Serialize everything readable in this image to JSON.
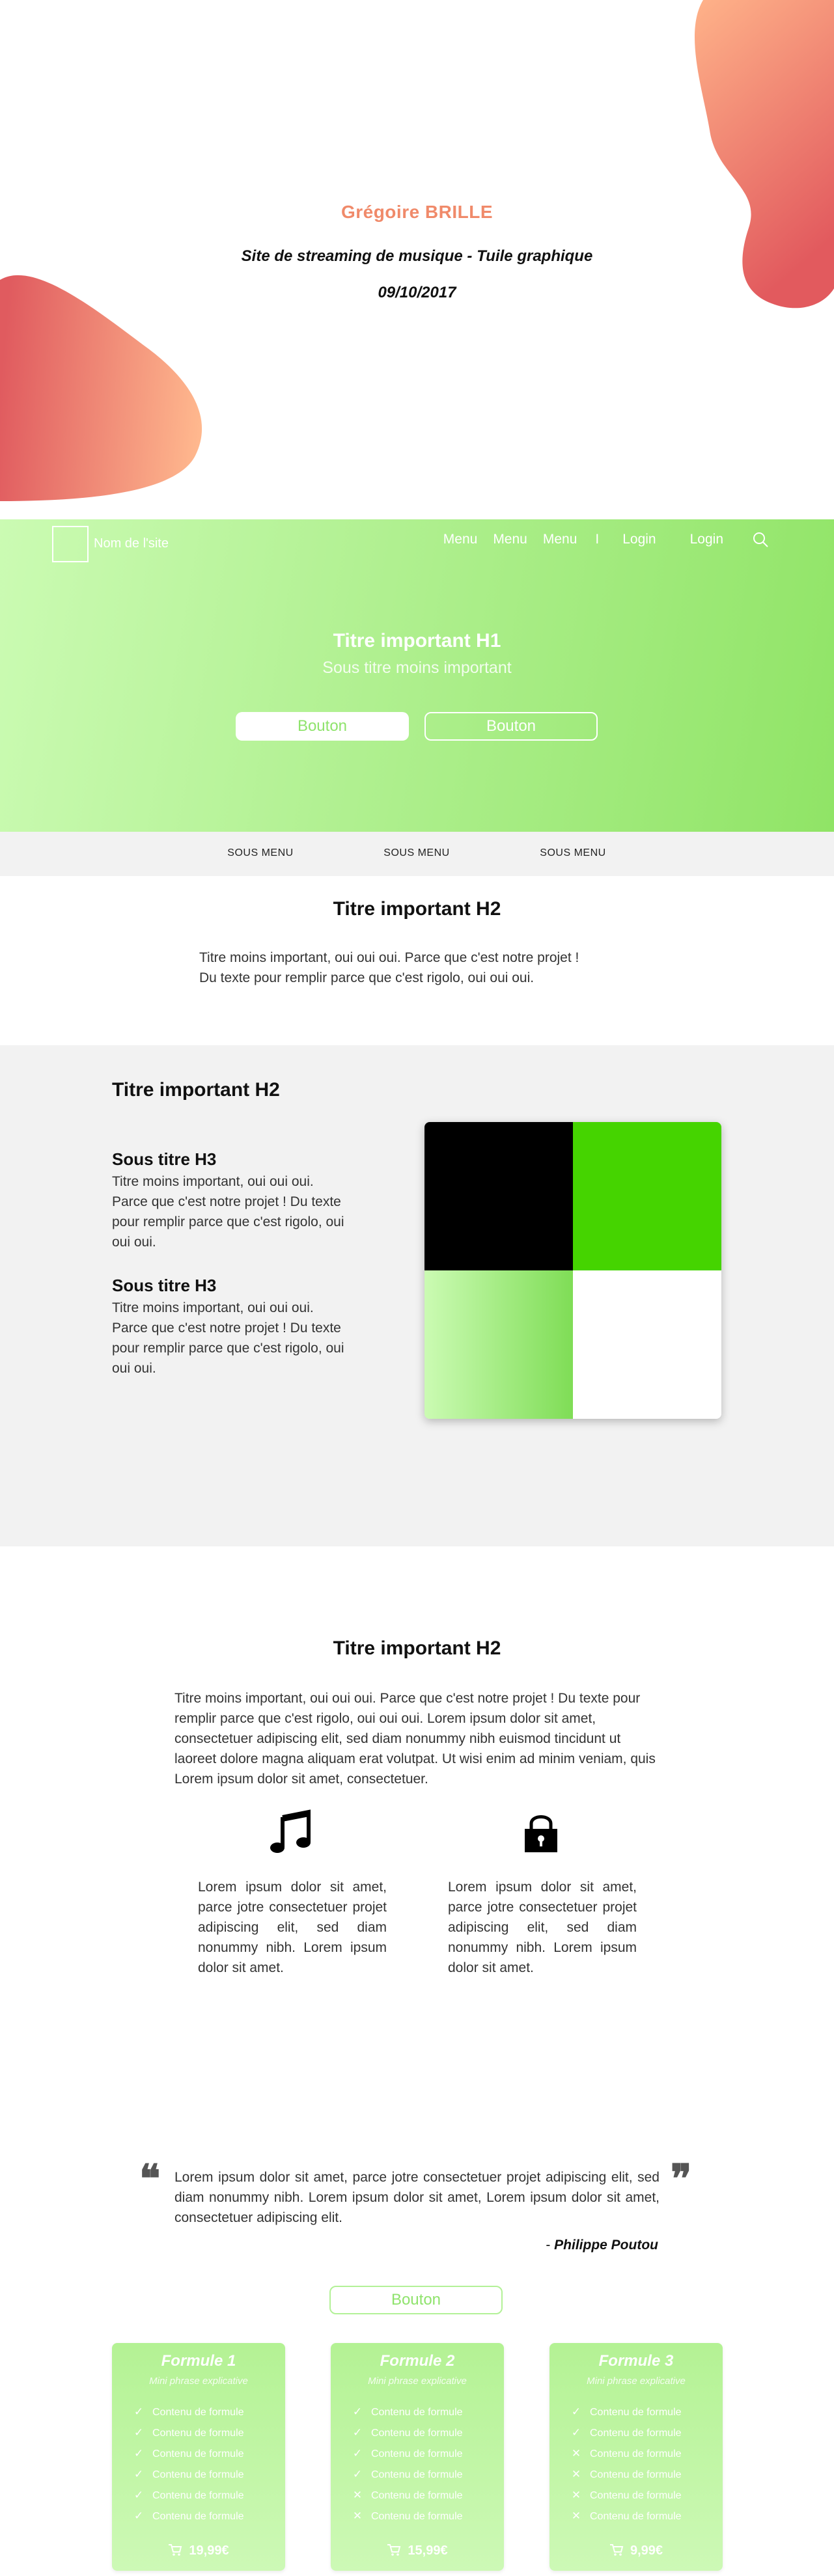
{
  "cover": {
    "author": "Grégoire BRILLE",
    "subtitle": "Site de streaming de musique - Tuile graphique",
    "date": "09/10/2017",
    "accent_color": "#f08a6a"
  },
  "header": {
    "site_name": "Nom de l'site",
    "nav": [
      "Menu",
      "Menu",
      "Menu"
    ],
    "separator": "I",
    "login_items": [
      "Login",
      "Login"
    ],
    "search_icon": "search-icon"
  },
  "hero": {
    "h1": "Titre important H1",
    "subtitle": "Sous titre moins important",
    "button_primary": "Bouton",
    "button_secondary": "Bouton",
    "gradient": [
      "#cbfbb3",
      "#90e466"
    ]
  },
  "submenu": [
    "SOUS MENU",
    "SOUS MENU",
    "SOUS MENU"
  ],
  "intro": {
    "title": "Titre important H2",
    "line1": "Titre moins important, oui oui oui. Parce que c'est notre projet !",
    "line2": "Du texte pour remplir parce que c'est rigolo, oui oui oui."
  },
  "showcase": {
    "title": "Titre important H2",
    "blocks": [
      {
        "h3": "Sous titre H3",
        "text": "Titre moins important, oui oui oui. Parce que c'est notre projet ! Du texte pour remplir parce que c'est rigolo, oui oui oui."
      },
      {
        "h3": "Sous titre H3",
        "text": "Titre moins important, oui oui oui. Parce que c'est notre projet ! Du texte pour remplir parce que c'est rigolo, oui oui oui."
      }
    ],
    "tile_colors": [
      "#000000",
      "#45d400",
      "#9ee87c",
      "#ffffff"
    ]
  },
  "features": {
    "title": "Titre important H2",
    "text": "Titre moins important, oui oui oui. Parce que c'est notre projet ! Du texte pour remplir parce que c'est rigolo, oui oui oui. Lorem ipsum dolor sit amet, consectetuer adipiscing elit, sed diam nonummy nibh euismod tincidunt ut laoreet dolore magna aliquam erat volutpat. Ut wisi enim ad minim veniam, quis Lorem ipsum dolor sit amet, consectetuer.",
    "columns": [
      {
        "icon": "music-note-icon",
        "text": "Lorem ipsum dolor sit amet, parce jotre consectetuer projet adipiscing elit, sed diam nonummy nibh. Lorem ipsum dolor sit amet."
      },
      {
        "icon": "padlock-icon",
        "text": "Lorem ipsum dolor sit amet, parce jotre consectetuer projet adipiscing elit, sed diam nonummy nibh. Lorem ipsum dolor sit amet."
      }
    ]
  },
  "quote": {
    "open_mark": "❝",
    "close_mark": "❞",
    "text": "Lorem ipsum dolor sit amet, parce jotre consectetuer projet adipiscing elit, sed diam nonummy nibh.  Lorem ipsum dolor sit amet, Lorem ipsum dolor sit amet, consectetuer adipiscing elit.",
    "dash": "- ",
    "author": "Philippe Poutou"
  },
  "pricing": {
    "button": "Bouton",
    "cards": [
      {
        "title": "Formule 1",
        "subtitle": "Mini phrase explicative",
        "features": [
          "Contenu de formule",
          "Contenu de formule",
          "Contenu de formule",
          "Contenu de formule",
          "Contenu de formule",
          "Contenu de formule"
        ],
        "included": [
          true,
          true,
          true,
          true,
          true,
          true
        ],
        "price": "19,99€"
      },
      {
        "title": "Formule 2",
        "subtitle": "Mini phrase explicative",
        "features": [
          "Contenu de formule",
          "Contenu de formule",
          "Contenu de formule",
          "Contenu de formule",
          "Contenu de formule",
          "Contenu de formule"
        ],
        "included": [
          true,
          true,
          true,
          true,
          false,
          false
        ],
        "price": "15,99€"
      },
      {
        "title": "Formule 3",
        "subtitle": "Mini phrase explicative",
        "features": [
          "Contenu de formule",
          "Contenu de formule",
          "Contenu de formule",
          "Contenu de formule",
          "Contenu de formule",
          "Contenu de formule"
        ],
        "included": [
          true,
          true,
          false,
          false,
          false,
          false
        ],
        "price": "9,99€"
      }
    ],
    "check_icon": "check-icon",
    "cross_icon": "cross-icon",
    "cart_icon": "cart-icon"
  }
}
